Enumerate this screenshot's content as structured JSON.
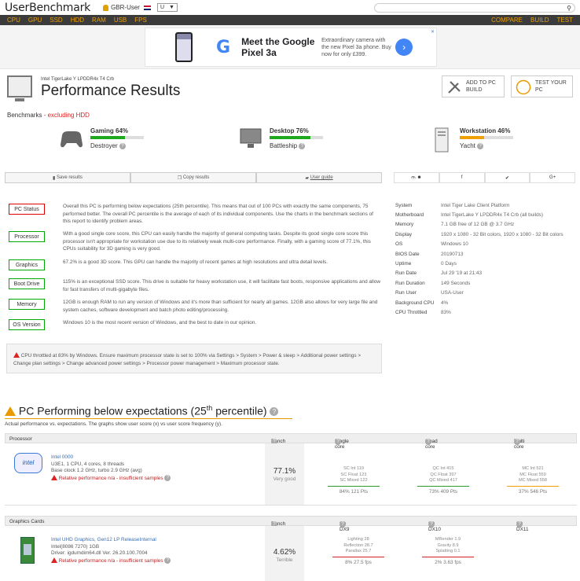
{
  "header": {
    "logo": "UserBenchmark",
    "user": "GBR-User",
    "country_select": "U",
    "search_icon": "search-icon"
  },
  "nav": {
    "left": [
      "CPU",
      "GPU",
      "SSD",
      "HDD",
      "RAM",
      "USB",
      "FPS"
    ],
    "right": [
      "COMPARE",
      "BUILD",
      "TEST"
    ]
  },
  "ad": {
    "title": "Meet the Google Pixel 3a",
    "body": "Extraordinary camera with the new Pixel 3a phone. Buy now for only £399.",
    "logo": "G",
    "go": "›",
    "close": "✕"
  },
  "page": {
    "machine": "Intel TigerLake Y LPDDR4x T4 Crb",
    "title": "Performance Results",
    "add_to_pc": "ADD TO PC BUILD",
    "test_your_pc": "TEST YOUR PC"
  },
  "benchmarks": {
    "label": "Benchmarks",
    "note": " - excluding HDD",
    "items": [
      {
        "name": "Gaming 64%",
        "rank": "Destroyer",
        "pct": 64,
        "color": "#1ea81e"
      },
      {
        "name": "Desktop 76%",
        "rank": "Battleship",
        "pct": 76,
        "color": "#1ea81e"
      },
      {
        "name": "Workstation 46%",
        "rank": "Yacht",
        "pct": 46,
        "color": "#f0a000"
      }
    ]
  },
  "actions": {
    "save": "Save results",
    "copy": "Copy results",
    "guide": "User guide"
  },
  "share": [
    "ரூ ☻",
    "f",
    "✔",
    "G+"
  ],
  "cards": [
    {
      "tag": "PC Status",
      "red": true,
      "text": "Overall this PC is performing below expectations (25th percentile). This means that out of 100 PCs with exactly the same components, 75 performed better. The overall PC percentile is the average of each of its individual components. Use the charts in the benchmark sections of this report to identify problem areas."
    },
    {
      "tag": "Processor",
      "red": false,
      "text": "With a good single core score, this CPU can easily handle the majority of general computing tasks. Despite its good single core score this processor isn't appropriate for workstation use due to its relatively weak multi-core performance. Finally, with a gaming score of 77.1%, this CPUs suitability for 3D gaming is very good."
    },
    {
      "tag": "Graphics",
      "red": false,
      "text": "67.2% is a good 3D score. This GPU can handle the majority of recent games at high resolutions and ultra detail levels."
    },
    {
      "tag": "Boot Drive",
      "red": false,
      "text": "115% is an exceptional SSD score. This drive is suitable for heavy workstation use, it will facilitate fast boots, responsive applications and allow for fast transfers of multi-gigabyte files."
    },
    {
      "tag": "Memory",
      "red": false,
      "text": "12GB is enough RAM to run any version of Windows and it's more than sufficient for nearly all games. 12GB also allows for very large file and system caches, software development and batch photo editing/processing."
    },
    {
      "tag": "OS Version",
      "red": false,
      "text": "Windows 10 is the most recent version of Windows, and the best to date in our opinion."
    }
  ],
  "specs": [
    {
      "k": "System",
      "v": "Intel Tiger Lake Client Platform"
    },
    {
      "k": "Motherboard",
      "v": "Intel TigerLake Y LPDDR4x T4 Crb (all builds)"
    },
    {
      "k": "Memory",
      "v": "7.1 GB free of 12 GB @ 3.7 GHz"
    },
    {
      "k": "Display",
      "v": "1920 x 1080 - 32 Bit colors, 1920 x 1080 - 32 Bit colors"
    },
    {
      "k": "OS",
      "v": "Windows 10"
    },
    {
      "k": "BIOS Date",
      "v": "20190713"
    },
    {
      "k": "Uptime",
      "v": "0 Days"
    },
    {
      "k": "Run Date",
      "v": "Jul 29 '19 at 21:43"
    },
    {
      "k": "Run Duration",
      "v": "149 Seconds"
    },
    {
      "k": "Run User",
      "v": "USA-User"
    },
    {
      "k": "Background CPU",
      "v": "4%"
    },
    {
      "k": "CPU Throttled",
      "v": "83%"
    }
  ],
  "warning": "CPU throttled at 83% by Windows. Ensure maximum processor state is set to 100% via Settings > System > Power & sleep > Additional power settings > Change plan settings > Change advanced power settings > Processor power management > Maximum processor state.",
  "perf": {
    "heading_pre": "PC Performing below expectations (25",
    "heading_sup": "th",
    "heading_post": " percentile)",
    "sub": "Actual performance vs. expectations. The graphs show user score (x) vs user score frequency (y)."
  },
  "processor": {
    "head": [
      "Processor",
      "Bench",
      "Single core",
      "Quad core",
      "Multi core"
    ],
    "name": "Intel 0000",
    "l2": "U3E1, 1 CPU, 4 cores, 8 threads",
    "l3": "Base clock 1.2 GHz, turbo 2.9 GHz (avg)",
    "l4": "Relative performance n/a - insufficient samples",
    "score": "77.1%",
    "rating": "Very good",
    "single": [
      "SC Int 119",
      "SC Float 123",
      "SC Mixed 122"
    ],
    "single_pct": "84% 121 Pts",
    "quad": [
      "QC Int 415",
      "QC Float 397",
      "QC Mixed 417"
    ],
    "quad_pct": "73% 409 Pts",
    "multi": [
      "MC Int 521",
      "MC Float 559",
      "MC Mixed 558"
    ],
    "multi_pct": "37% 546 Pts"
  },
  "graphics": {
    "head": [
      "Graphics Cards",
      "Bench",
      "3D DX9",
      "3D DX10",
      "3D DX11"
    ],
    "name": "Intel UHD Graphics, Gen12 LP ReleaseInternal",
    "l2": "Intel(8086 7270) 1GB",
    "l3": "Driver: igdumdim64.dll Ver. 26.20.100.7004",
    "l4": "Relative performance n/a - insufficient samples",
    "score": "4.62%",
    "rating": "Terrible",
    "dx9": [
      "Lighting 28",
      "Reflection 28.7",
      "Parallax 25.7"
    ],
    "dx9_pct": "8% 27.5 fps",
    "dx10": [
      "MRender 1.9",
      "Gravity 8.9",
      "Splatting 0.1"
    ],
    "dx10_pct": "2% 3.63 fps"
  }
}
